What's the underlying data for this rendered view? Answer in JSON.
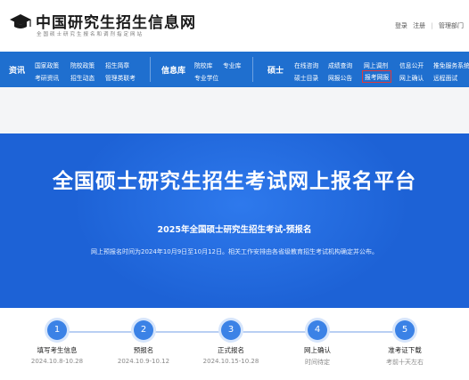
{
  "header": {
    "title": "中国研究生招生信息网",
    "subtitle": "全国硕士研究生报名和调剂指定网站",
    "links": [
      "登录",
      "注册",
      "|",
      "管理部门"
    ]
  },
  "nav": {
    "sections": [
      "资讯",
      "信息库",
      "硕士"
    ],
    "zixun": [
      [
        "国家政策",
        "院校政策",
        "招生简章"
      ],
      [
        "考研资讯",
        "招生动态",
        "管理类联考"
      ]
    ],
    "xinxiku": [
      [
        "院校库",
        "专业库"
      ],
      [
        "专业学位"
      ]
    ],
    "shuoshi": [
      [
        "在线咨询",
        "成绩查询",
        "网上调剂",
        "信息公开",
        "推免服务系统"
      ],
      [
        "硕士目录",
        "网报公告",
        "报考网报",
        "网上确认",
        "远程面试"
      ]
    ],
    "highlighted": "报考网报"
  },
  "hero": {
    "title": "全国硕士研究生招生考试网上报名平台",
    "subtitle": "2025年全国硕士研究生招生考试-预报名",
    "description": "网上预报名时间为2024年10月9日至10月12日。相关工作安排由各省级教育招生考试机构确定并公布。"
  },
  "steps": [
    {
      "num": "1",
      "name": "填写考生信息",
      "date": "2024.10.8-10.28"
    },
    {
      "num": "2",
      "name": "预报名",
      "date": "2024.10.9-10.12"
    },
    {
      "num": "3",
      "name": "正式报名",
      "date": "2024.10.15-10.28"
    },
    {
      "num": "4",
      "name": "网上确认",
      "date": "时间待定"
    },
    {
      "num": "5",
      "name": "准考证下载",
      "date": "考前十天左右"
    }
  ],
  "colors": {
    "nav_bg": "#1f6fcf",
    "hero_bg": "#1d62d6",
    "step_circle": "#3b82e6",
    "highlight_border": "#e23a3a"
  }
}
